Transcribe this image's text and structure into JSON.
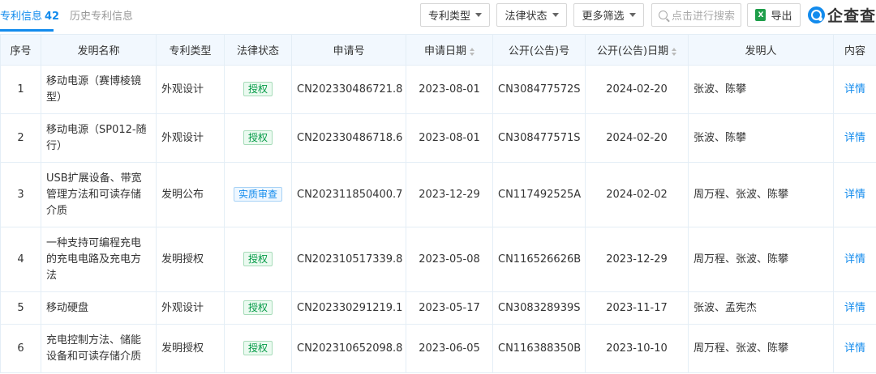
{
  "tabs": {
    "active_label": "专利信息",
    "active_count": "42",
    "history_label": "历史专利信息"
  },
  "toolbar": {
    "filter_patent_type": "专利类型",
    "filter_legal_status": "法律状态",
    "filter_more": "更多筛选",
    "search_placeholder": "点击进行搜索",
    "export_label": "导出",
    "excel_glyph": "X",
    "logo_text": "企查查"
  },
  "table": {
    "headers": [
      "序号",
      "发明名称",
      "专利类型",
      "法律状态",
      "申请号",
      "申请日期",
      "公开(公告)号",
      "公开(公告)日期",
      "发明人",
      "内容"
    ],
    "rows": [
      {
        "index": "1",
        "name": "移动电源（赛博棱镜型）",
        "type": "外观设计",
        "status": "授权",
        "status_color": "green",
        "app_no": "CN202330486721.8",
        "app_date": "2023-08-01",
        "pub_no": "CN308477572S",
        "pub_date": "2024-02-20",
        "inventors": "张波、陈攀",
        "action": "详情"
      },
      {
        "index": "2",
        "name": "移动电源（SP012-随行）",
        "type": "外观设计",
        "status": "授权",
        "status_color": "green",
        "app_no": "CN202330486718.6",
        "app_date": "2023-08-01",
        "pub_no": "CN308477571S",
        "pub_date": "2024-02-20",
        "inventors": "张波、陈攀",
        "action": "详情"
      },
      {
        "index": "3",
        "name": "USB扩展设备、带宽管理方法和可读存储介质",
        "type": "发明公布",
        "status": "实质审查",
        "status_color": "blue",
        "app_no": "CN202311850400.7",
        "app_date": "2023-12-29",
        "pub_no": "CN117492525A",
        "pub_date": "2024-02-02",
        "inventors": "周万程、张波、陈攀",
        "action": "详情"
      },
      {
        "index": "4",
        "name": "一种支持可编程充电的充电电路及充电方法",
        "type": "发明授权",
        "status": "授权",
        "status_color": "green",
        "app_no": "CN202310517339.8",
        "app_date": "2023-05-08",
        "pub_no": "CN116526626B",
        "pub_date": "2023-12-29",
        "inventors": "周万程、张波、陈攀",
        "action": "详情"
      },
      {
        "index": "5",
        "name": "移动硬盘",
        "type": "外观设计",
        "status": "授权",
        "status_color": "green",
        "app_no": "CN202330291219.1",
        "app_date": "2023-05-17",
        "pub_no": "CN308328939S",
        "pub_date": "2023-11-17",
        "inventors": "张波、孟宪杰",
        "action": "详情"
      },
      {
        "index": "6",
        "name": "充电控制方法、储能设备和可读存储介质",
        "type": "发明授权",
        "status": "授权",
        "status_color": "green",
        "app_no": "CN202310652098.8",
        "app_date": "2023-06-05",
        "pub_no": "CN116388350B",
        "pub_date": "2023-10-10",
        "inventors": "周万程、张波、陈攀",
        "action": "详情"
      }
    ]
  },
  "colors": {
    "accent": "#128bed",
    "status_green": "#009944",
    "status_blue": "#128bed",
    "header_bg": "#f2f8fe"
  }
}
